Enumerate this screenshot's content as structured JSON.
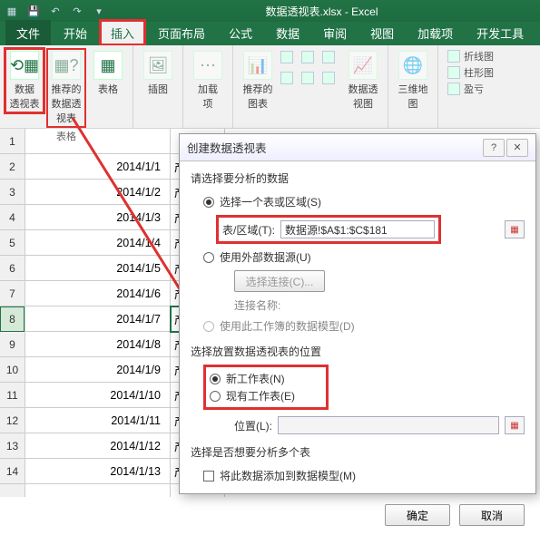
{
  "titlebar": {
    "filename": "数据透视表.xlsx - Excel"
  },
  "tabs": {
    "file": "文件",
    "home": "开始",
    "insert": "插入",
    "layout": "页面布局",
    "formulas": "公式",
    "data": "数据",
    "review": "审阅",
    "view": "视图",
    "addins": "加载项",
    "developer": "开发工具"
  },
  "ribbon": {
    "pivot": "数据\n透视表",
    "recommended_pivot": "推荐的\n数据透视表",
    "table": "表格",
    "group_tables": "表格",
    "illustration": "插图",
    "addins": "加载\n项",
    "recommended_chart": "推荐的\n图表",
    "pivot_chart": "数据透视图",
    "map3d": "三维地\n图",
    "sparkline_line": "折线图",
    "sparkline_column": "柱形图",
    "sparkline_winloss": "盈亏"
  },
  "grid": {
    "rows": [
      {
        "n": "1",
        "a": ""
      },
      {
        "n": "2",
        "a": "2014/1/1"
      },
      {
        "n": "3",
        "a": "2014/1/2"
      },
      {
        "n": "4",
        "a": "2014/1/3"
      },
      {
        "n": "5",
        "a": "2014/1/4"
      },
      {
        "n": "6",
        "a": "2014/1/5"
      },
      {
        "n": "7",
        "a": "2014/1/6"
      },
      {
        "n": "8",
        "a": "2014/1/7"
      },
      {
        "n": "9",
        "a": "2014/1/8"
      },
      {
        "n": "10",
        "a": "2014/1/9"
      },
      {
        "n": "11",
        "a": "2014/1/10"
      },
      {
        "n": "12",
        "a": "2014/1/11"
      },
      {
        "n": "13",
        "a": "2014/1/12"
      },
      {
        "n": "14",
        "a": "2014/1/13"
      }
    ],
    "colB_char": "产"
  },
  "dialog": {
    "title": "创建数据透视表",
    "sec1": "请选择要分析的数据",
    "opt_select_range": "选择一个表或区域(S)",
    "range_label": "表/区域(T):",
    "range_value": "数据源!$A$1:$C$181",
    "opt_external": "使用外部数据源(U)",
    "choose_conn": "选择连接(C)...",
    "conn_name_label": "连接名称:",
    "opt_datamodel": "使用此工作簿的数据模型(D)",
    "sec2": "选择放置数据透视表的位置",
    "opt_new_sheet": "新工作表(N)",
    "opt_existing_sheet": "现有工作表(E)",
    "location_label": "位置(L):",
    "sec3": "选择是否想要分析多个表",
    "chk_add_model": "将此数据添加到数据模型(M)",
    "ok": "确定",
    "cancel": "取消"
  }
}
